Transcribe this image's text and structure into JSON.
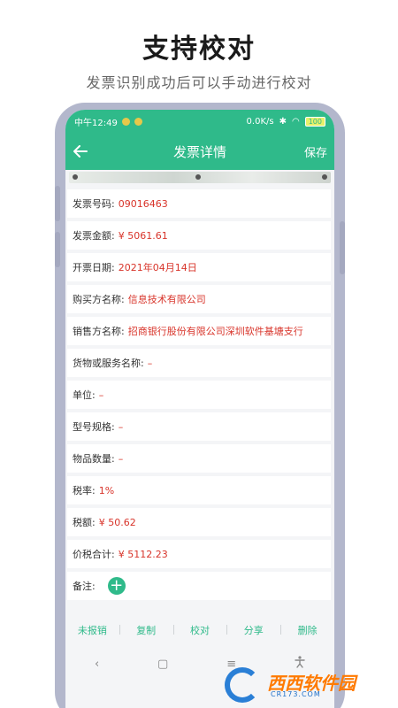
{
  "promo": {
    "title": "支持校对",
    "subtitle": "发票识别成功后可以手动进行校对"
  },
  "status_bar": {
    "time": "中午12:49",
    "speed": "0.0K/s",
    "battery": "100"
  },
  "app_bar": {
    "back_icon": "arrow-left-icon",
    "title": "发票详情",
    "save_label": "保存"
  },
  "fields": [
    {
      "label": "发票号码:",
      "value": "09016463"
    },
    {
      "label": "发票金额:",
      "value": "¥ 5061.61"
    },
    {
      "label": "开票日期:",
      "value": "2021年04月14日"
    },
    {
      "label": "购买方名称:",
      "value": "信息技术有限公司"
    },
    {
      "label": "销售方名称:",
      "value": "招商银行股份有限公司深圳软件基塘支行"
    },
    {
      "label": "货物或服务名称:",
      "value": "–"
    },
    {
      "label": "单位:",
      "value": "–"
    },
    {
      "label": "型号规格:",
      "value": "–"
    },
    {
      "label": "物品数量:",
      "value": "–"
    },
    {
      "label": "税率:",
      "value": "1%"
    },
    {
      "label": "税额:",
      "value": "¥ 50.62"
    },
    {
      "label": "价税合计:",
      "value": "¥ 5112.23"
    }
  ],
  "remark": {
    "label": "备注:",
    "add_icon": "plus-icon"
  },
  "toolbar": {
    "items": [
      "未报销",
      "复制",
      "校对",
      "分享",
      "删除"
    ]
  },
  "navbar": {
    "back": "‹",
    "home": "▢",
    "menu": "≡",
    "accessibility": "accessibility-icon"
  },
  "watermark": {
    "brand": "西西软件园",
    "domain": "CR173.COM"
  },
  "colors": {
    "accent": "#2fba8a",
    "value_red": "#d8342a",
    "frame": "#b3b7cc"
  }
}
